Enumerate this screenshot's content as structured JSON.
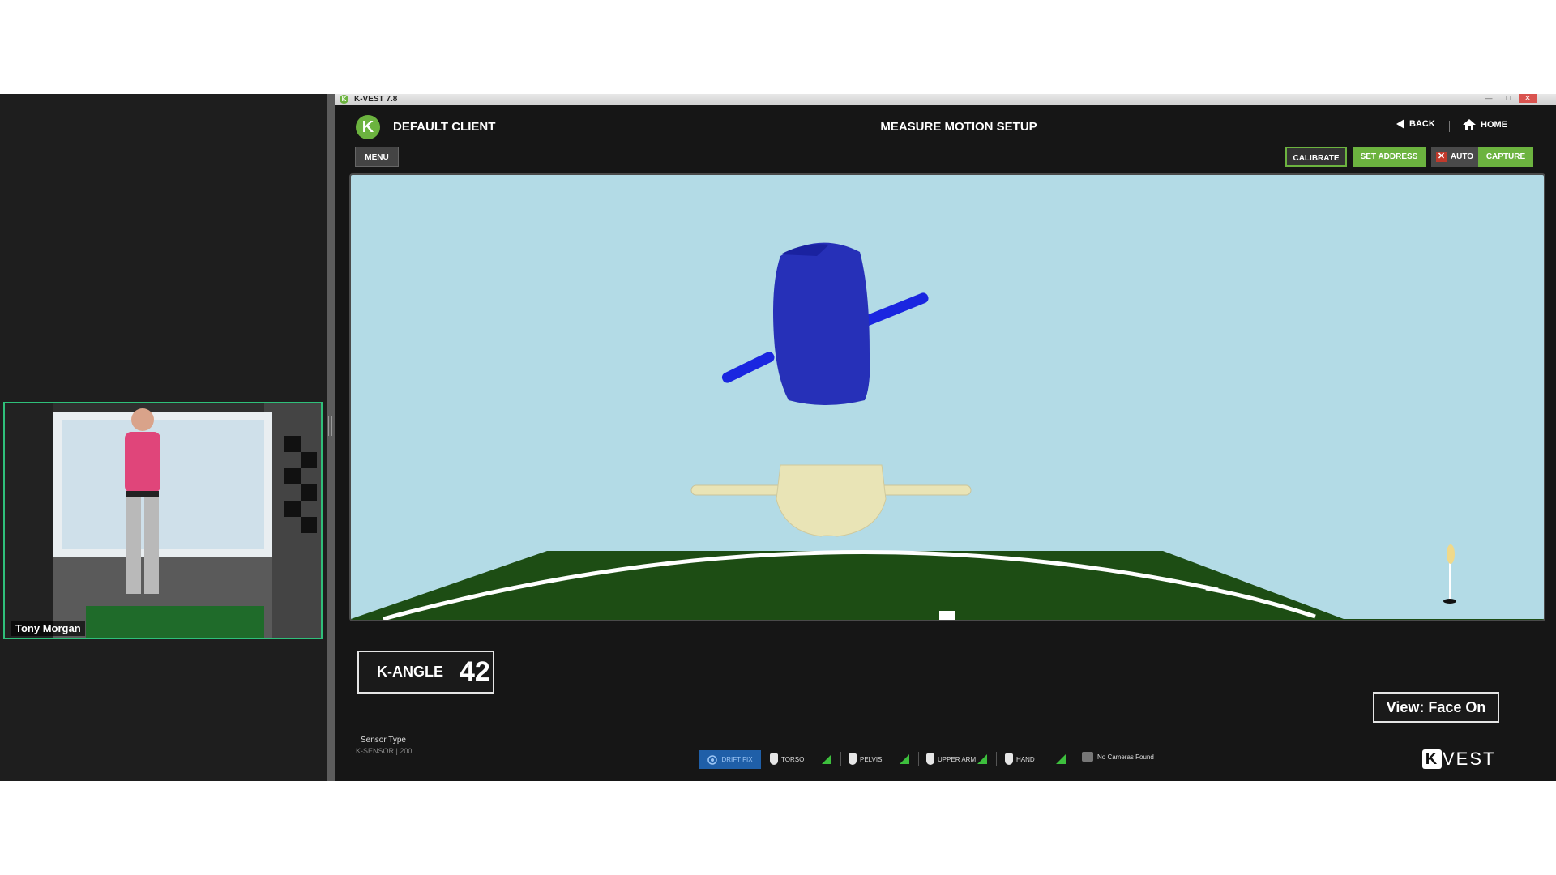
{
  "participant": {
    "name": "Tony Morgan"
  },
  "window": {
    "title": "K-VEST 7.8"
  },
  "header": {
    "client_name": "DEFAULT CLIENT",
    "screen_title": "MEASURE MOTION SETUP",
    "back_label": "BACK",
    "home_label": "HOME"
  },
  "toolbar": {
    "menu_label": "MENU",
    "calibrate_label": "CALIBRATE",
    "set_address_label": "SET ADDRESS",
    "auto_label": "AUTO",
    "capture_label": "CAPTURE"
  },
  "viewport": {
    "k_angle_label": "K-ANGLE",
    "k_angle_value": "42",
    "view_label": "View: Face On"
  },
  "status_bar": {
    "sensor_type_label": "Sensor Type",
    "sensor_type_value": "K-SENSOR | 200",
    "drift_fix_label": "DRIFT FIX",
    "sensors": [
      "TORSO",
      "PELVIS",
      "UPPER ARM",
      "HAND"
    ],
    "camera_status": "No Cameras Found"
  },
  "branding": {
    "logo_text": "VEST"
  },
  "colors": {
    "accent_green": "#6cb33f",
    "sky": "#b3dbe6",
    "ground": "#1d4d14",
    "torso": "#2630b8",
    "pelvis": "#e9e4b6"
  }
}
